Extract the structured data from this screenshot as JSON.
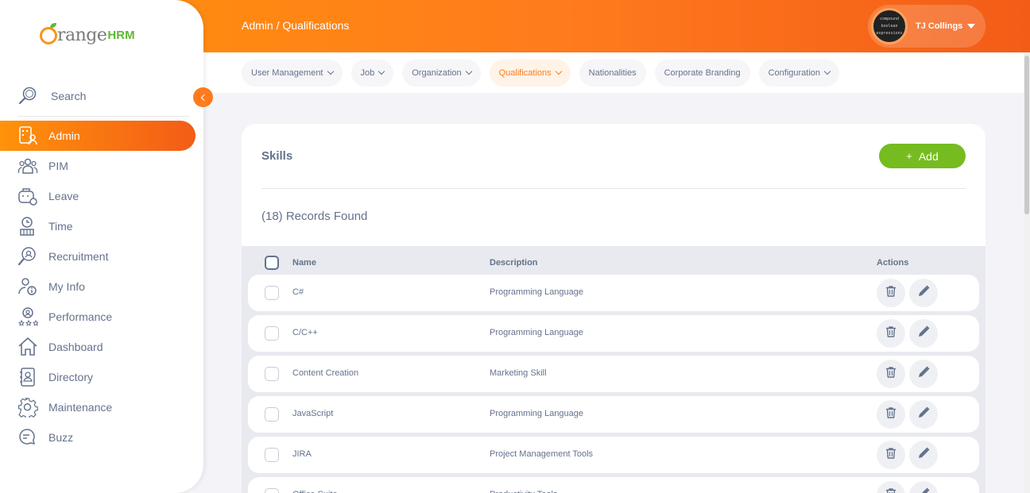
{
  "header": {
    "breadcrumb": "Admin / Qualifications",
    "user_name": "TJ Collings",
    "avatar_text": [
      "compound",
      "boolean",
      "expressions"
    ]
  },
  "nav": {
    "items": [
      {
        "label": "User Management",
        "has_dropdown": true,
        "active": false
      },
      {
        "label": "Job",
        "has_dropdown": true,
        "active": false
      },
      {
        "label": "Organization",
        "has_dropdown": true,
        "active": false
      },
      {
        "label": "Qualifications",
        "has_dropdown": true,
        "active": true
      },
      {
        "label": "Nationalities",
        "has_dropdown": false,
        "active": false
      },
      {
        "label": "Corporate Branding",
        "has_dropdown": false,
        "active": false
      },
      {
        "label": "Configuration",
        "has_dropdown": true,
        "active": false
      }
    ]
  },
  "sidebar": {
    "logo_text": "range",
    "logo_suffix": "HRM",
    "search_label": "Search",
    "items": [
      {
        "label": "Admin",
        "icon": "admin-icon",
        "active": true
      },
      {
        "label": "PIM",
        "icon": "pim-icon",
        "active": false
      },
      {
        "label": "Leave",
        "icon": "leave-icon",
        "active": false
      },
      {
        "label": "Time",
        "icon": "time-icon",
        "active": false
      },
      {
        "label": "Recruitment",
        "icon": "recruitment-icon",
        "active": false
      },
      {
        "label": "My Info",
        "icon": "my-info-icon",
        "active": false
      },
      {
        "label": "Performance",
        "icon": "performance-icon",
        "active": false
      },
      {
        "label": "Dashboard",
        "icon": "dashboard-icon",
        "active": false
      },
      {
        "label": "Directory",
        "icon": "directory-icon",
        "active": false
      },
      {
        "label": "Maintenance",
        "icon": "maintenance-icon",
        "active": false
      },
      {
        "label": "Buzz",
        "icon": "buzz-icon",
        "active": false
      }
    ]
  },
  "main": {
    "title": "Skills",
    "add_label": "Add",
    "add_icon": "plus-icon",
    "records_found": "(18) Records Found",
    "table": {
      "headers": {
        "name": "Name",
        "description": "Description",
        "actions": "Actions"
      },
      "rows": [
        {
          "name": "C#",
          "description": "Programming Language"
        },
        {
          "name": "C/C++",
          "description": "Programming Language"
        },
        {
          "name": "Content Creation",
          "description": "Marketing Skill"
        },
        {
          "name": "JavaScript",
          "description": "Programming Language"
        },
        {
          "name": "JIRA",
          "description": "Project Management Tools"
        },
        {
          "name": "Office Suite",
          "description": "Productivity Tools"
        }
      ],
      "row_action_icons": [
        "trash-icon",
        "pencil-icon"
      ]
    }
  },
  "colors": {
    "brand_orange": "#ff7b1d",
    "add_green": "#76bc21",
    "text_slate": "#64728c"
  }
}
